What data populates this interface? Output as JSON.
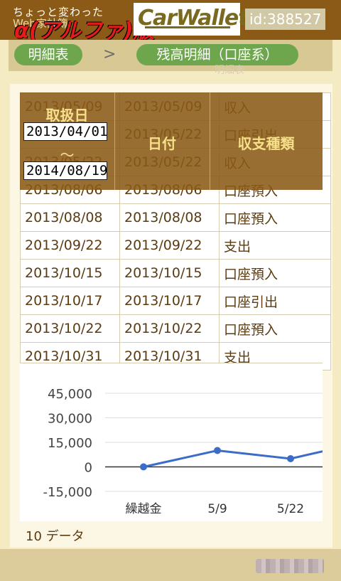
{
  "header": {
    "logo_line1": "ちょっと変わった",
    "logo_line2": "Web家計簿",
    "logo_big": "α(アルファ)版",
    "logo_wordmark": "CarWallet",
    "user_id": "id:388527"
  },
  "nav": {
    "crumb1": "明細表",
    "separator": ">",
    "crumb2": "残高明細（口座系）",
    "ghost_text": "明細表"
  },
  "table": {
    "headers": {
      "col1": "取扱日",
      "col2": "日付",
      "col3": "収支種類",
      "tilde": "～"
    },
    "date_from": "2013/04/01",
    "date_to": "2014/08/19",
    "rows": [
      [
        "2013/05/09",
        "2013/05/09",
        "収入"
      ],
      [
        "2013/05/22",
        "2013/05/22",
        "口座引出"
      ],
      [
        "2013/05/22",
        "2013/05/22",
        "収入"
      ],
      [
        "2013/08/06",
        "2013/08/06",
        "口座預入"
      ],
      [
        "2013/08/08",
        "2013/08/08",
        "口座預入"
      ],
      [
        "2013/09/22",
        "2013/09/22",
        "支出"
      ],
      [
        "2013/10/15",
        "2013/10/15",
        "口座預入"
      ],
      [
        "2013/10/17",
        "2013/10/17",
        "口座引出"
      ],
      [
        "2013/10/22",
        "2013/10/22",
        "口座預入"
      ],
      [
        "2013/10/31",
        "2013/10/31",
        "支出"
      ]
    ]
  },
  "chart_data": {
    "type": "line",
    "categories": [
      "繰越金",
      "5/9",
      "5/22",
      ""
    ],
    "series": [
      {
        "values": [
          0,
          10000,
          5000,
          9500
        ]
      }
    ],
    "yticks": [
      "45,000",
      "30,000",
      "15,000",
      "0",
      "-15,000"
    ],
    "ylim": [
      -15000,
      45000
    ],
    "line_color": "#3a6cc8",
    "grid": true
  },
  "count_label": "10 データ"
}
